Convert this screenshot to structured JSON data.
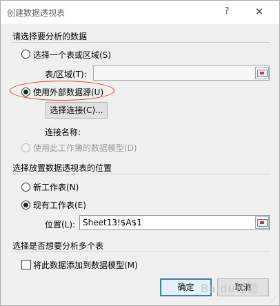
{
  "dialog": {
    "title": "创建数据透视表",
    "help_glyph": "?",
    "close_glyph": "✕"
  },
  "section_source": {
    "title": "请选择要分析的数据",
    "option_range": "选择一个表或区域(S)",
    "range_label": "表/区域(T):",
    "range_value": "",
    "option_external": "使用外部数据源(U)",
    "choose_connection": "选择连接(C)...",
    "connection_name_label": "连接名称:",
    "option_data_model": "使用此工作簿的数据模型(D)"
  },
  "section_location": {
    "title": "选择放置数据透视表的位置",
    "option_new": "新工作表(N)",
    "option_existing": "现有工作表(E)",
    "location_label": "位置(L):",
    "location_value": "Sheet13!$A$1"
  },
  "section_multi": {
    "title": "选择是否想要分析多个表",
    "add_to_model": "将此数据添加到数据模型(M)"
  },
  "buttons": {
    "ok": "确定",
    "cancel": "取消"
  },
  "state": {
    "selected_source": "external",
    "selected_location": "existing",
    "add_to_model_checked": false
  },
  "watermark": "Baidu经验",
  "colors": {
    "annotation": "#e0342b",
    "dialog_bg": "#f0f0f0",
    "default_button_border": "#3c7fb1"
  }
}
